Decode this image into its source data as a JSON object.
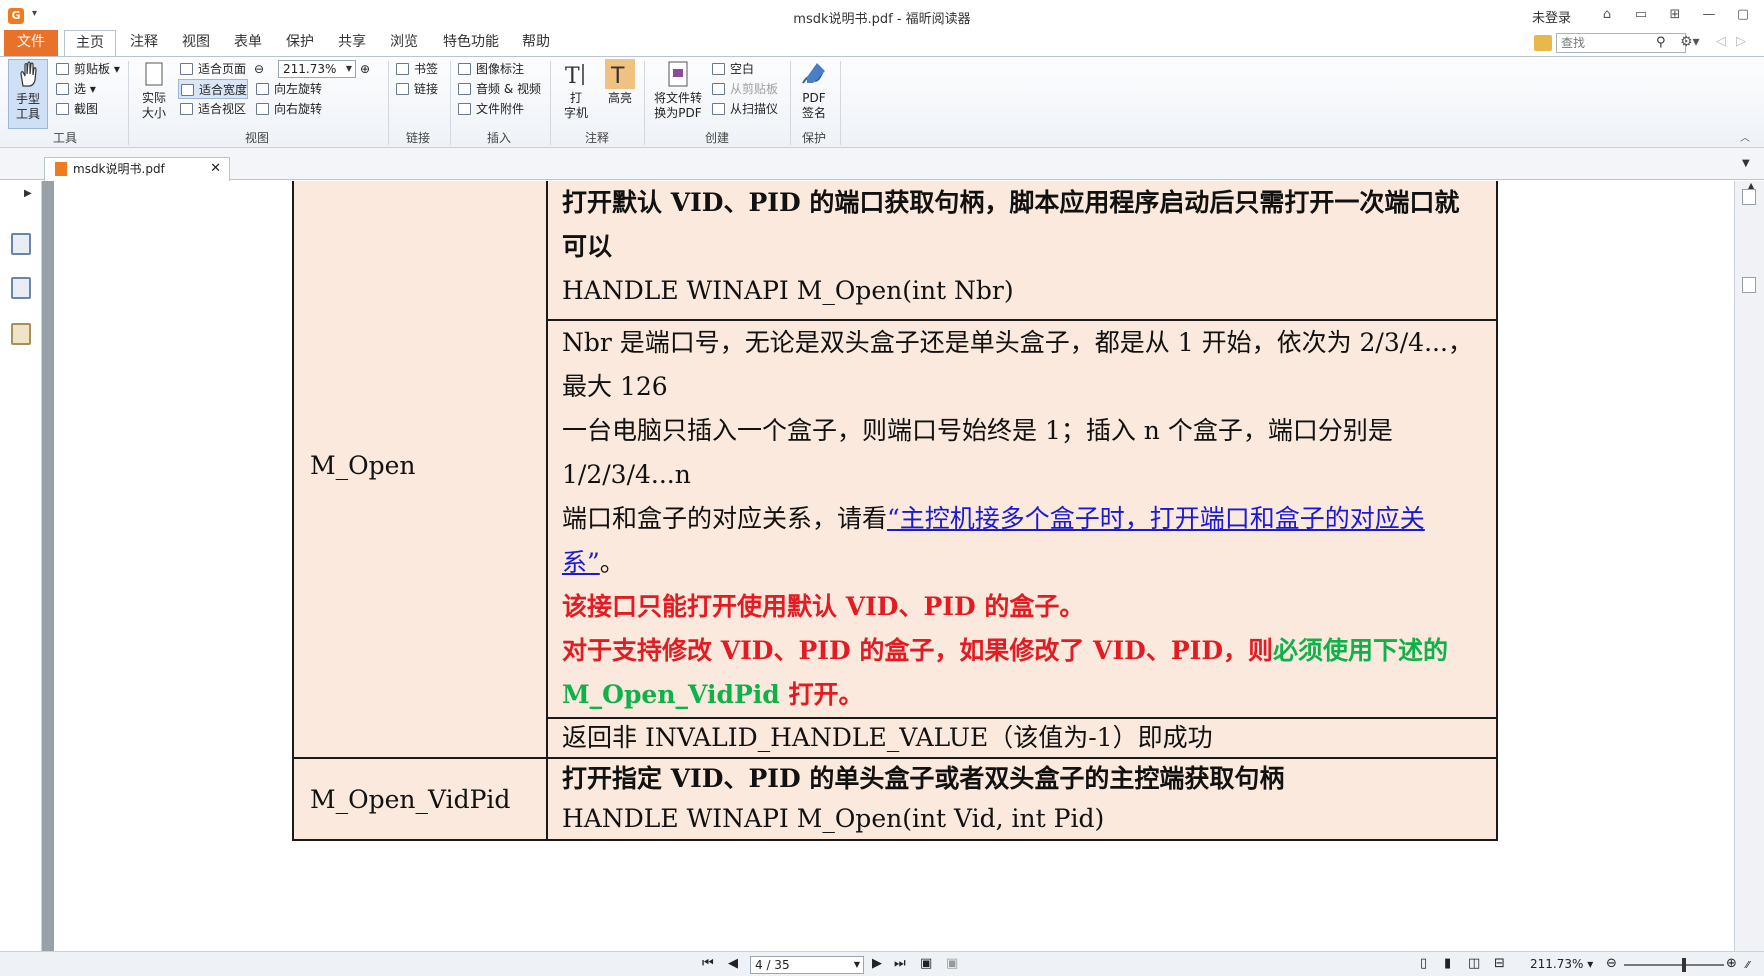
{
  "window": {
    "title": "msdk说明书.pdf - 福昕阅读器",
    "login": "未登录",
    "logo": "G"
  },
  "tabs": [
    {
      "label": "文件"
    },
    {
      "label": "主页"
    },
    {
      "label": "注释"
    },
    {
      "label": "视图"
    },
    {
      "label": "表单"
    },
    {
      "label": "保护"
    },
    {
      "label": "共享"
    },
    {
      "label": "浏览"
    },
    {
      "label": "特色功能"
    },
    {
      "label": "帮助"
    }
  ],
  "search": {
    "placeholder": "查找"
  },
  "ribbon": {
    "hand_tool": "手型\n工具",
    "clipboard": "剪贴板",
    "select": "选",
    "screenshot": "截图",
    "group_tools": "工具",
    "actual_size": "实际\n大小",
    "fit_page": "适合页面",
    "fit_width": "适合宽度",
    "fit_view": "适合视区",
    "zoom_value": "211.73%",
    "rotate_left": "向左旋转",
    "rotate_right": "向右旋转",
    "group_view": "视图",
    "bookmark": "书签",
    "link": "链接",
    "group_link": "链接",
    "image_annot": "图像标注",
    "audio_video": "音频 & 视频",
    "file_attach": "文件附件",
    "group_insert": "插入",
    "typewriter": "打\n字机",
    "highlight": "高亮",
    "group_annot": "注释",
    "convert_pdf": "将文件转\n换为PDF",
    "blank": "空白",
    "from_clipboard": "从剪贴板",
    "from_scanner": "从扫描仪",
    "group_create": "创建",
    "pdf_sign": "PDF\n签名",
    "group_protect": "保护"
  },
  "document_tab": {
    "label": "msdk说明书.pdf"
  },
  "doc": {
    "open_name": "M_Open",
    "open_title": "打开默认 VID、PID 的端口获取句柄，脚本应用程序启动后只需打开一次端口就可以",
    "open_sig": "HANDLE WINAPI M_Open(int Nbr)",
    "nbr_line1": "Nbr 是端口号，无论是双头盒子还是单头盒子，都是从 1 开始，依次为 2/3/4...，最大 126",
    "nbr_line2": "一台电脑只插入一个盒子，则端口号始终是 1；插入 n 个盒子，端口分别是 1/2/3/4...n",
    "nbr_line3_pre": "端口和盒子的对应关系，请看",
    "nbr_line3_link": "“主控机接多个盒子时，打开端口和盒子的对应关系”",
    "nbr_line3_post": "。",
    "warn1": "该接口只能打开使用默认 VID、PID 的盒子。",
    "warn2_red": "对于支持修改 VID、PID 的盒子，如果修改了 VID、PID，则",
    "warn2_green": "必须使用下述的 M_Open_VidPid",
    "warn2_red2": " 打开。",
    "ret": "返回非 INVALID_HANDLE_VALUE（该值为-1）即成功",
    "vid_name": "M_Open_VidPid",
    "vid_title": "打开指定 VID、PID 的单头盒子或者双头盒子的主控端获取句柄",
    "vid_sig": "HANDLE WINAPI M_Open(int Vid, int Pid)"
  },
  "status": {
    "page": "4 / 35",
    "zoom": "211.73%"
  },
  "colors": {
    "accent": "#e8722a",
    "cell_bg": "#fae9dc",
    "warn_red": "#e31b23",
    "warn_green": "#0fb14a",
    "link": "#1a1ad6"
  }
}
